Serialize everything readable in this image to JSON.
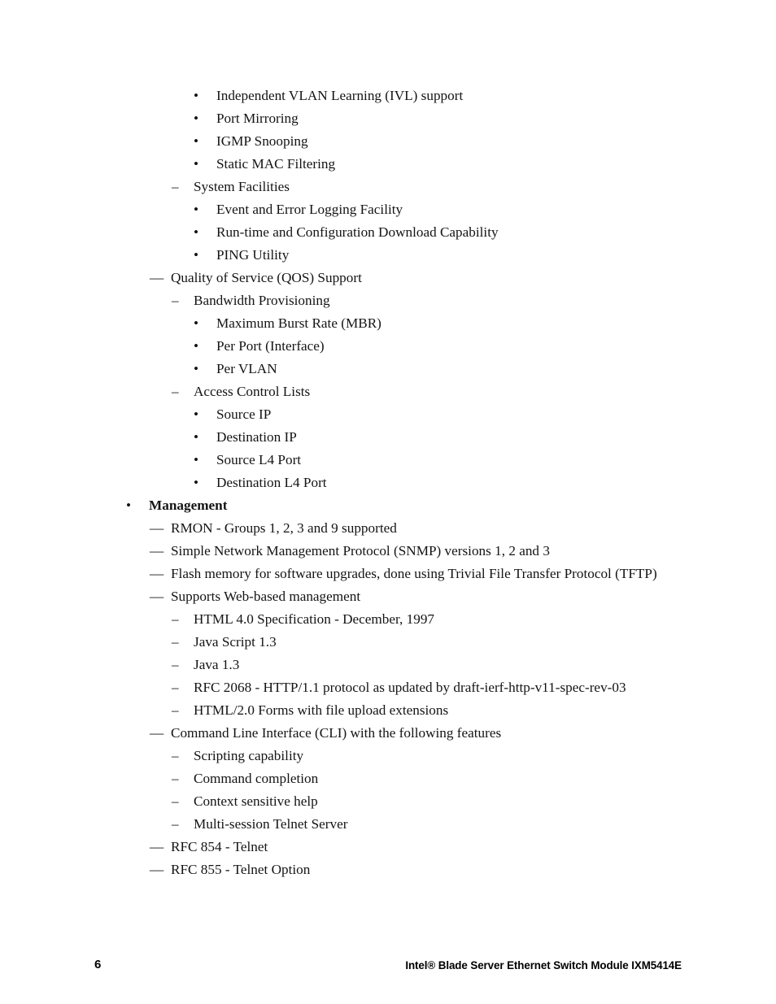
{
  "document": {
    "title": "Intel® Blade Server Ethernet Switch Module IXM5414E",
    "page_number": "6"
  },
  "markers": {
    "bullet": "•",
    "em_dash": "—",
    "en_dash": "–"
  },
  "content": {
    "items": [
      {
        "level": 4,
        "marker": "•",
        "text": "Independent VLAN Learning (IVL) support",
        "bold": false
      },
      {
        "level": 4,
        "marker": "•",
        "text": "Port Mirroring",
        "bold": false
      },
      {
        "level": 4,
        "marker": "•",
        "text": "IGMP Snooping",
        "bold": false
      },
      {
        "level": 4,
        "marker": "•",
        "text": "Static MAC Filtering",
        "bold": false
      },
      {
        "level": 3,
        "marker": "–",
        "text": "System Facilities",
        "bold": false
      },
      {
        "level": 4,
        "marker": "•",
        "text": "Event and Error Logging Facility",
        "bold": false
      },
      {
        "level": 4,
        "marker": "•",
        "text": "Run-time and Configuration Download Capability",
        "bold": false
      },
      {
        "level": 4,
        "marker": "•",
        "text": "PING Utility",
        "bold": false
      },
      {
        "level": 2,
        "marker": "—",
        "text": "Quality of Service (QOS) Support",
        "bold": false
      },
      {
        "level": 3,
        "marker": "–",
        "text": "Bandwidth Provisioning",
        "bold": false
      },
      {
        "level": 4,
        "marker": "•",
        "text": "Maximum Burst Rate (MBR)",
        "bold": false
      },
      {
        "level": 4,
        "marker": "•",
        "text": "Per Port (Interface)",
        "bold": false
      },
      {
        "level": 4,
        "marker": "•",
        "text": "Per VLAN",
        "bold": false
      },
      {
        "level": 3,
        "marker": "–",
        "text": "Access Control Lists",
        "bold": false
      },
      {
        "level": 4,
        "marker": "•",
        "text": "Source IP",
        "bold": false
      },
      {
        "level": 4,
        "marker": "•",
        "text": "Destination IP",
        "bold": false
      },
      {
        "level": 4,
        "marker": "•",
        "text": "Source L4 Port",
        "bold": false
      },
      {
        "level": 4,
        "marker": "•",
        "text": "Destination L4 Port",
        "bold": false
      },
      {
        "level": 1,
        "marker": "•",
        "text": "Management",
        "bold": true
      },
      {
        "level": 2,
        "marker": "—",
        "text": "RMON - Groups 1, 2, 3 and 9 supported",
        "bold": false
      },
      {
        "level": 2,
        "marker": "—",
        "text": "Simple Network Management Protocol (SNMP) versions 1, 2 and 3",
        "bold": false
      },
      {
        "level": 2,
        "marker": "—",
        "text": "Flash memory for software upgrades, done using Trivial File Transfer Protocol (TFTP)",
        "bold": false
      },
      {
        "level": 2,
        "marker": "—",
        "text": "Supports Web-based management",
        "bold": false
      },
      {
        "level": 3,
        "marker": "–",
        "text": "HTML 4.0 Specification - December, 1997",
        "bold": false
      },
      {
        "level": 3,
        "marker": "–",
        "text": "Java Script 1.3",
        "bold": false
      },
      {
        "level": 3,
        "marker": "–",
        "text": "Java 1.3",
        "bold": false
      },
      {
        "level": 3,
        "marker": "–",
        "text": "RFC 2068 - HTTP/1.1 protocol as updated by draft-ierf-http-v11-spec-rev-03",
        "bold": false
      },
      {
        "level": 3,
        "marker": "–",
        "text": "HTML/2.0 Forms with file upload extensions",
        "bold": false
      },
      {
        "level": 2,
        "marker": "—",
        "text": "Command Line Interface (CLI) with the following features",
        "bold": false
      },
      {
        "level": 3,
        "marker": "–",
        "text": "Scripting capability",
        "bold": false
      },
      {
        "level": 3,
        "marker": "–",
        "text": "Command completion",
        "bold": false
      },
      {
        "level": 3,
        "marker": "–",
        "text": "Context sensitive help",
        "bold": false
      },
      {
        "level": 3,
        "marker": "–",
        "text": "Multi-session Telnet Server",
        "bold": false
      },
      {
        "level": 2,
        "marker": "—",
        "text": "RFC 854 - Telnet",
        "bold": false
      },
      {
        "level": 2,
        "marker": "—",
        "text": "RFC 855 - Telnet Option",
        "bold": false
      }
    ]
  }
}
